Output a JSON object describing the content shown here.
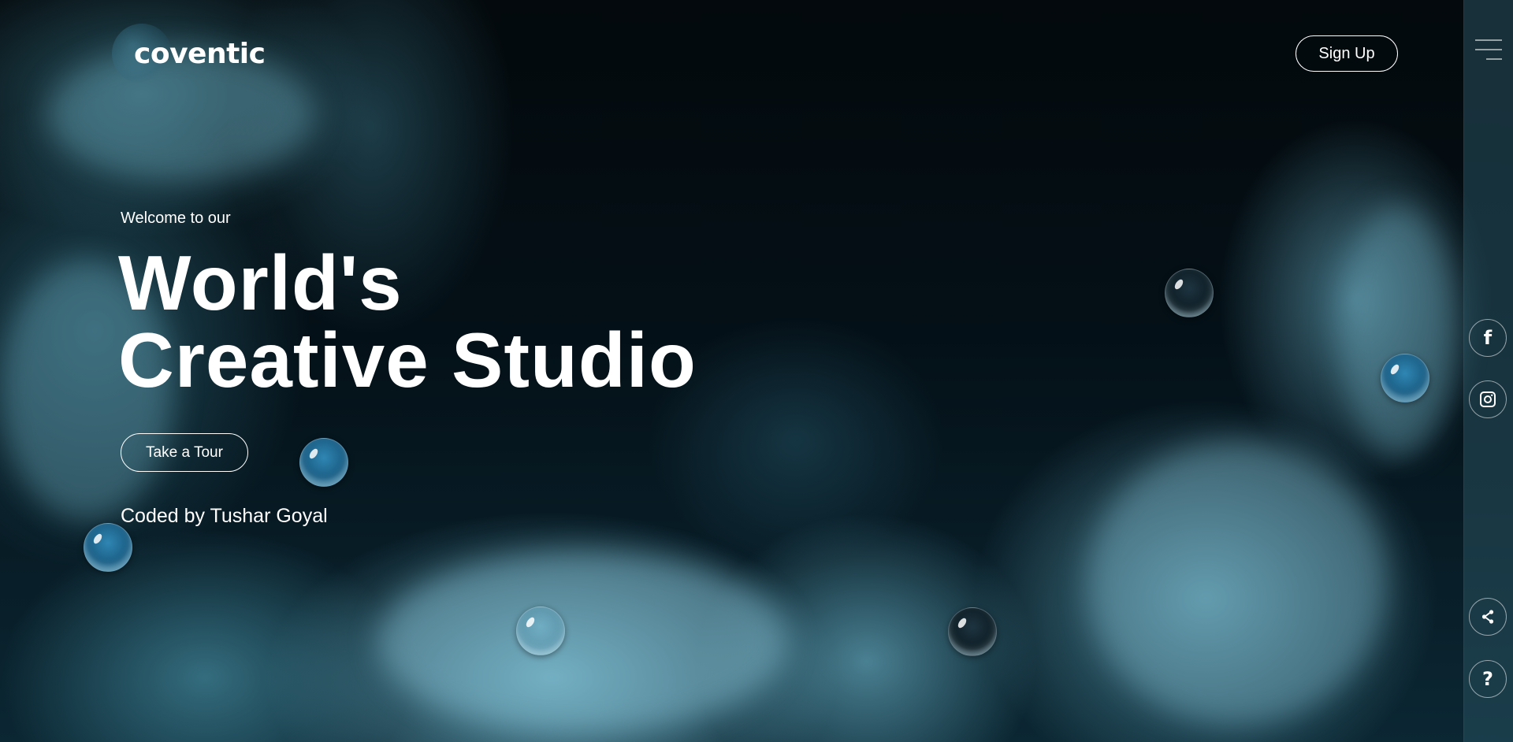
{
  "brand": {
    "logo_text": "coventic"
  },
  "header": {
    "signup_label": "Sign Up",
    "menu_icon": "hamburger-menu-icon"
  },
  "hero": {
    "welcome": "Welcome to our",
    "title_line1": "World's",
    "title_line2": "Creative Studio",
    "tour_label": "Take a Tour",
    "credit": "Coded by Tushar Goyal"
  },
  "sidebar": {
    "icons": [
      "facebook-icon",
      "instagram-icon",
      "share-icon",
      "help-icon"
    ],
    "facebook_glyph": "f",
    "help_glyph": "?"
  },
  "theme": {
    "accent": "#ffffff",
    "background": "#02080b",
    "smoke": "#6fb0c6"
  }
}
